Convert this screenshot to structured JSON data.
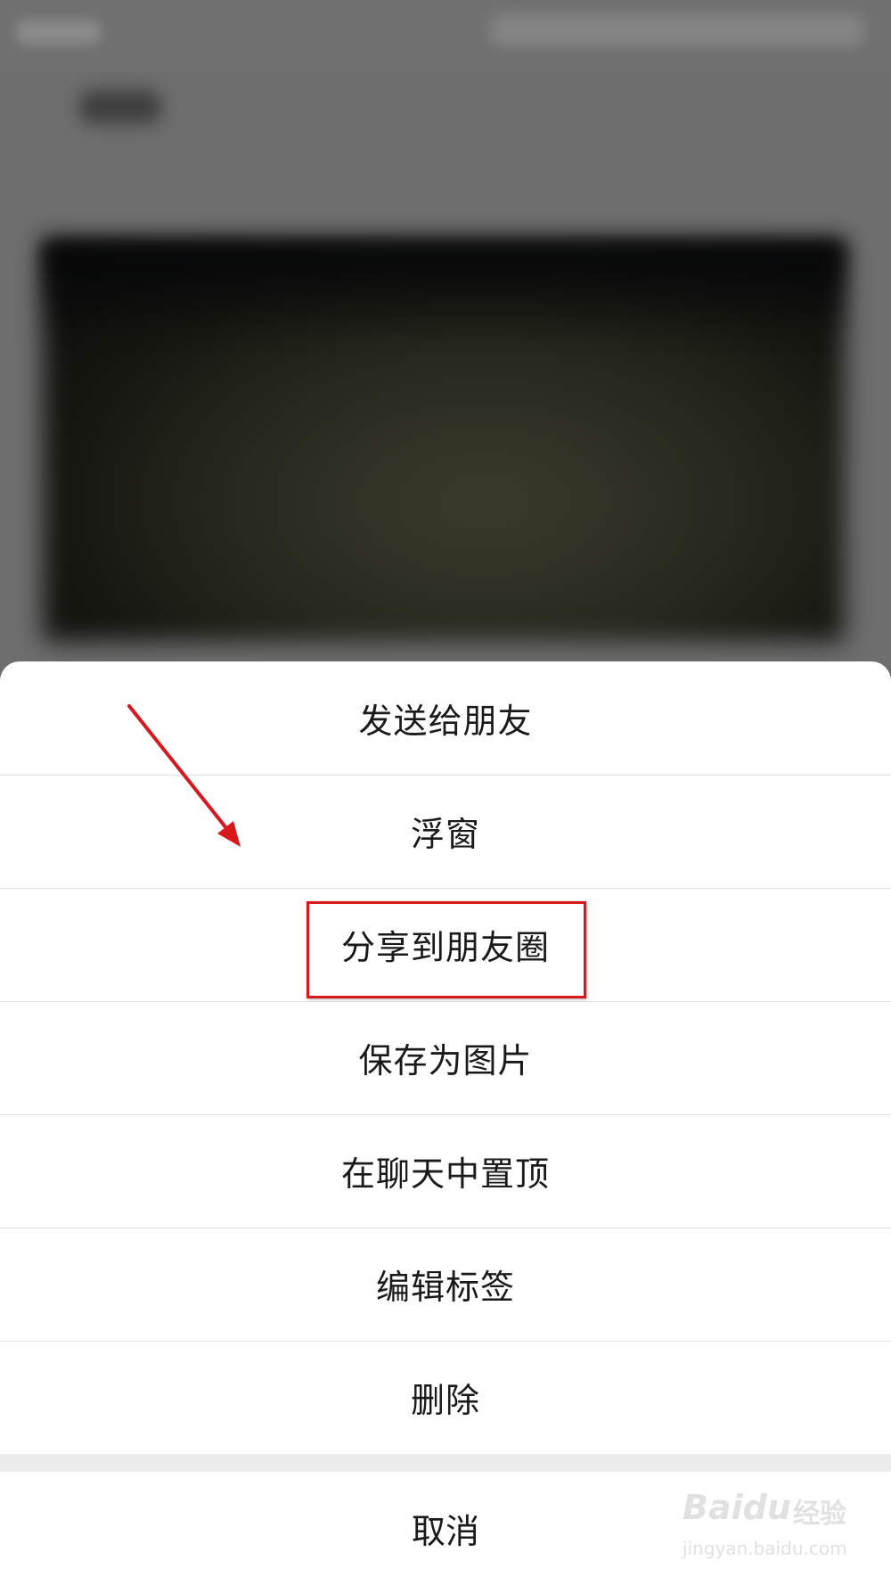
{
  "menu": {
    "items": [
      {
        "label": "发送给朋友"
      },
      {
        "label": "浮窗"
      },
      {
        "label": "分享到朋友圈"
      },
      {
        "label": "保存为图片"
      },
      {
        "label": "在聊天中置顶"
      },
      {
        "label": "编辑标签"
      },
      {
        "label": "删除"
      }
    ],
    "cancel_label": "取消"
  },
  "annotation": {
    "highlight_color": "#d8181c",
    "highlighted_item": "分享到朋友圈"
  },
  "watermark": {
    "brand": "Baidu",
    "suffix": "经验",
    "url": "jingyan.baidu.com"
  },
  "colors": {
    "overlay": "#6e6e6e",
    "sheet_bg": "#ffffff",
    "text": "#1a1a1a",
    "divider": "#e2e2e2"
  }
}
